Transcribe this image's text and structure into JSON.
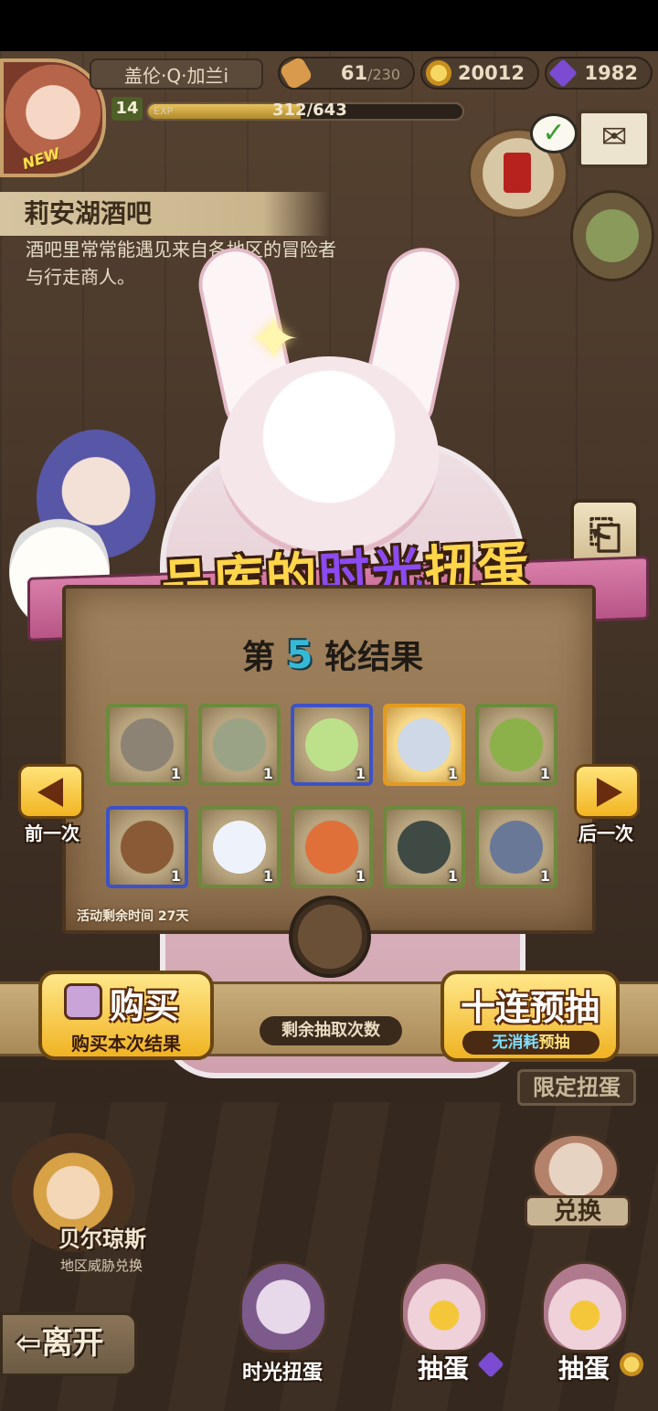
{
  "header": {
    "player_name": "盖伦·Q·加兰i",
    "avatar_tag": "NEW",
    "level": "14",
    "exp_label": "EXP",
    "exp_text": "312/643",
    "exp_fraction": 0.485,
    "resources": {
      "bread_value": "61",
      "bread_max": "/230",
      "gold": "20012",
      "gems": "1982"
    }
  },
  "location": {
    "name": "莉安湖酒吧",
    "description": "酒吧里常常能遇见来自各地区的冒险者与行走商人。"
  },
  "event": {
    "title_part1": "品库的",
    "title_highlight": "时光",
    "title_part2": "扭蛋",
    "round_prefix": "第",
    "round_number": "5",
    "round_suffix": "轮结果",
    "remaining_time_label": "活动剩余时间",
    "remaining_time_value": "27天"
  },
  "results": [
    {
      "name": "grey-hair-item",
      "count": "1",
      "rarity": "green",
      "color": "#8c8375"
    },
    {
      "name": "leaf-feather-item",
      "count": "1",
      "rarity": "green",
      "color": "#9aa386"
    },
    {
      "name": "striped-egg-item",
      "count": "1",
      "rarity": "blue",
      "color": "#bde08a"
    },
    {
      "name": "pocket-watch-item",
      "count": "1",
      "rarity": "gold",
      "color": "#cfd8e6"
    },
    {
      "name": "sprout-seed-item",
      "count": "1",
      "rarity": "green",
      "color": "#8cb04a"
    },
    {
      "name": "bear-cake-item",
      "count": "1",
      "rarity": "blue",
      "color": "#8a5a36"
    },
    {
      "name": "cloud-ring-item",
      "count": "1",
      "rarity": "green",
      "color": "#eef3fb"
    },
    {
      "name": "orange-creature-item",
      "count": "1",
      "rarity": "green",
      "color": "#e0703a"
    },
    {
      "name": "turtle-shell-item",
      "count": "1",
      "rarity": "green",
      "color": "#3f4a44"
    },
    {
      "name": "seashell-item",
      "count": "1",
      "rarity": "green",
      "color": "#6a7898"
    }
  ],
  "navigation": {
    "prev_label": "前一次",
    "next_label": "后一次"
  },
  "actions": {
    "buy_main": "购买",
    "buy_sub": "购买本次结果",
    "draws_remaining_label": "剩余抽取次数",
    "ten_main": "十连预抽",
    "ten_sub_free": "无消耗",
    "ten_sub_rest": "预抽"
  },
  "scene": {
    "limited_tag": "限定扭蛋",
    "exchange_label": "兑换",
    "npc_name": "贝尔琼斯",
    "npc_sub": "地区威胁兑换",
    "leave_label": "离开",
    "dock": [
      {
        "label": "时光扭蛋"
      },
      {
        "label": "抽蛋",
        "currency": "gem"
      },
      {
        "label": "抽蛋",
        "currency": "gold"
      }
    ]
  }
}
